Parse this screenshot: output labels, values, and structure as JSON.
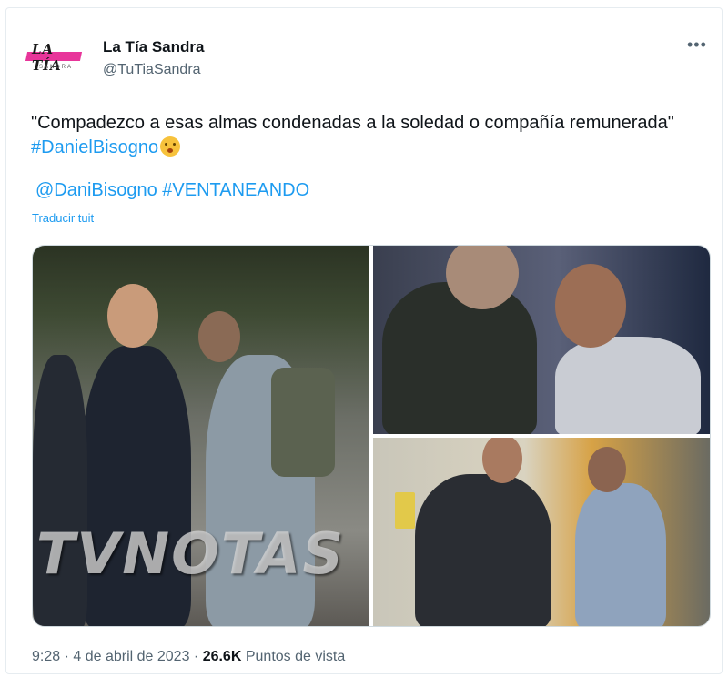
{
  "author": {
    "display_name": "La Tía Sandra",
    "handle": "@TuTiaSandra",
    "avatar_logo": "LA TÍA",
    "avatar_sub": "SANDRA",
    "avatar_color": "#e8359a"
  },
  "more_icon": "•••",
  "tweet": {
    "text_main": "\"Compadezco a esas almas condenadas a la soledad o compañía remunerada\"",
    "hashtag_1": "#DanielBisogno",
    "emoji": "shushing-face",
    "mention": "@DaniBisogno",
    "hashtag_2": "#VENTANEANDO",
    "translate_label": "Traducir tuit"
  },
  "media": {
    "watermark": "TVNOTAS",
    "photos": [
      "photo-1",
      "photo-2",
      "photo-3"
    ]
  },
  "footer": {
    "time": "9:28",
    "separator": " · ",
    "date": "4 de abril de 2023",
    "views_count": "26.6K",
    "views_label": "Puntos de vista"
  },
  "colors": {
    "link": "#1d9bf0",
    "secondary_text": "#536471",
    "primary_text": "#0f1419"
  }
}
